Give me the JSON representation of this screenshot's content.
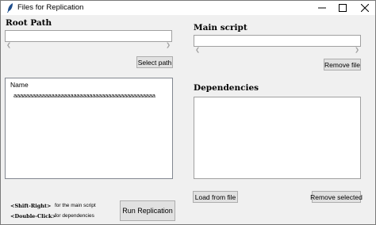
{
  "window": {
    "title": "Files for Replication"
  },
  "root_path": {
    "heading": "Root Path",
    "value": "",
    "select_label": "Select path"
  },
  "tree": {
    "column_name": "Name",
    "rows": [
      "aaaaaaaaaaaaaaaaaaaaaaaaaaaaaaaaaaaaaaaaaaaaa"
    ]
  },
  "main_script": {
    "heading": "Main script",
    "value": "",
    "remove_label": "Remove file"
  },
  "dependencies": {
    "heading": "Dependencies",
    "load_label": "Load from file",
    "remove_selected_label": "Remove selected"
  },
  "hints": {
    "shift_right_key": "<Shift-Right>",
    "shift_right_desc": "for the main script",
    "double_click_key": "<Double-Click>",
    "double_click_desc": "for dependencies"
  },
  "actions": {
    "run_label": "Run Replication"
  },
  "icons": {
    "app": "feather-icon",
    "minimize": "minimize-icon",
    "maximize": "maximize-icon",
    "close": "close-icon"
  }
}
